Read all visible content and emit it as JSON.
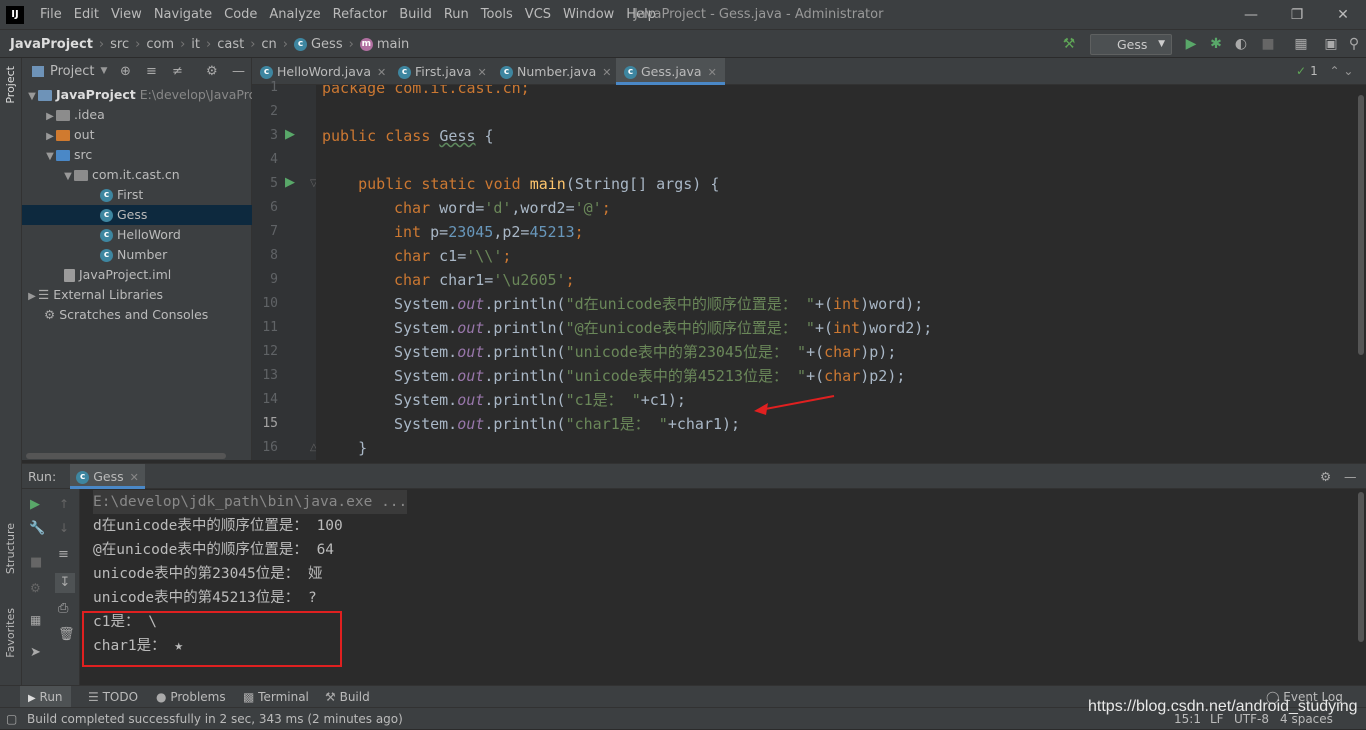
{
  "app": {
    "logo": "IJ",
    "title": "JavaProject - Gess.java - Administrator",
    "menu": [
      "File",
      "Edit",
      "View",
      "Navigate",
      "Code",
      "Analyze",
      "Refactor",
      "Build",
      "Run",
      "Tools",
      "VCS",
      "Window",
      "Help"
    ]
  },
  "breadcrumb": [
    "JavaProject",
    "src",
    "com",
    "it",
    "cast",
    "cn",
    "Gess",
    "main"
  ],
  "toolbar": {
    "run_config": "Gess"
  },
  "project_panel": {
    "title": "Project",
    "tree": [
      {
        "label": "JavaProject",
        "extra": "E:\\develop\\JavaPro",
        "kind": "root"
      },
      {
        "label": ".idea",
        "kind": "folder"
      },
      {
        "label": "out",
        "kind": "folder-orange"
      },
      {
        "label": "src",
        "kind": "folder-blue"
      },
      {
        "label": "com.it.cast.cn",
        "kind": "package"
      },
      {
        "label": "First",
        "kind": "class"
      },
      {
        "label": "Gess",
        "kind": "class",
        "selected": true
      },
      {
        "label": "HelloWord",
        "kind": "class"
      },
      {
        "label": "Number",
        "kind": "class"
      },
      {
        "label": "JavaProject.iml",
        "kind": "file"
      },
      {
        "label": "External Libraries",
        "kind": "libs"
      },
      {
        "label": "Scratches and Consoles",
        "kind": "scratch"
      }
    ]
  },
  "left_tool_tabs": {
    "project": "Project",
    "structure": "Structure",
    "favorites": "Favorites"
  },
  "editor_tabs": [
    {
      "label": "HelloWord.java"
    },
    {
      "label": "First.java"
    },
    {
      "label": "Number.java"
    },
    {
      "label": "Gess.java",
      "active": true
    }
  ],
  "inspection_count": "1",
  "line_numbers": [
    "1",
    "2",
    "3",
    "4",
    "5",
    "6",
    "7",
    "8",
    "9",
    "10",
    "11",
    "12",
    "13",
    "14",
    "15",
    "16"
  ],
  "code": {
    "l1": "package com.it.cast.cn;",
    "l3a": "public class ",
    "l3b": "Gess",
    "l3c": " {",
    "l5a": "    public static void ",
    "l5b": "main",
    "l5c": "(String[] args) {",
    "l6a": "char ",
    "l6b": "word=",
    "l6c": "'d'",
    "l6d": ",word2=",
    "l6e": "'@'",
    "l6f": ";",
    "l7a": "int ",
    "l7b": "p=",
    "l7c": "23045",
    "l7d": ",p2=",
    "l7e": "45213",
    "l7f": ";",
    "l8a": "char ",
    "l8b": "c1=",
    "l8c": "'\\\\'",
    "l8d": ";",
    "l9a": "char ",
    "l9b": "char1=",
    "l9c": "'\\u2605'",
    "l9d": ";",
    "pre": "System.",
    "out": "out",
    "println": ".println(",
    "l10s": "\"d在unicode表中的顺序位置是： \"",
    "l10r1": "+(",
    "l10k": "int",
    "l10r2": ")word);",
    "l11s": "\"@在unicode表中的顺序位置是： \"",
    "l11r1": "+(",
    "l11k": "int",
    "l11r2": ")word2);",
    "l12s": "\"unicode表中的第23045位是： \"",
    "l12r1": "+(",
    "l12k": "char",
    "l12r2": ")p);",
    "l13s": "\"unicode表中的第45213位是： \"",
    "l13r1": "+(",
    "l13k": "char",
    "l13r2": ")p2);",
    "l14s": "\"c1是： \"",
    "l14r": "+c1);",
    "l15s": "\"char1是： \"",
    "l15r": "+char1);",
    "l16": "    }"
  },
  "run_panel": {
    "label": "Run:",
    "tab": "Gess",
    "output": [
      "E:\\develop\\jdk_path\\bin\\java.exe ...",
      "d在unicode表中的顺序位置是： 100",
      "@在unicode表中的顺序位置是： 64",
      "unicode表中的第23045位是： 娅",
      "unicode表中的第45213位是： ?",
      "c1是： \\",
      "char1是： ★"
    ]
  },
  "bottom_tabs": [
    "Run",
    "TODO",
    "Problems",
    "Terminal",
    "Build"
  ],
  "event_log": "Event Log",
  "status": {
    "message": "Build completed successfully in 2 sec, 343 ms (2 minutes ago)",
    "position": "15:1",
    "line_sep": "LF",
    "encoding": "UTF-8",
    "indent": "4 spaces"
  },
  "watermark": "https://blog.csdn.net/android_studying",
  "colors": {
    "keyword": "#cc7832",
    "string": "#6a8759",
    "number": "#6897bb",
    "field": "#9876aa",
    "method": "#ffc66d",
    "annotation_red": "#e02020",
    "selection": "#0d293e"
  }
}
